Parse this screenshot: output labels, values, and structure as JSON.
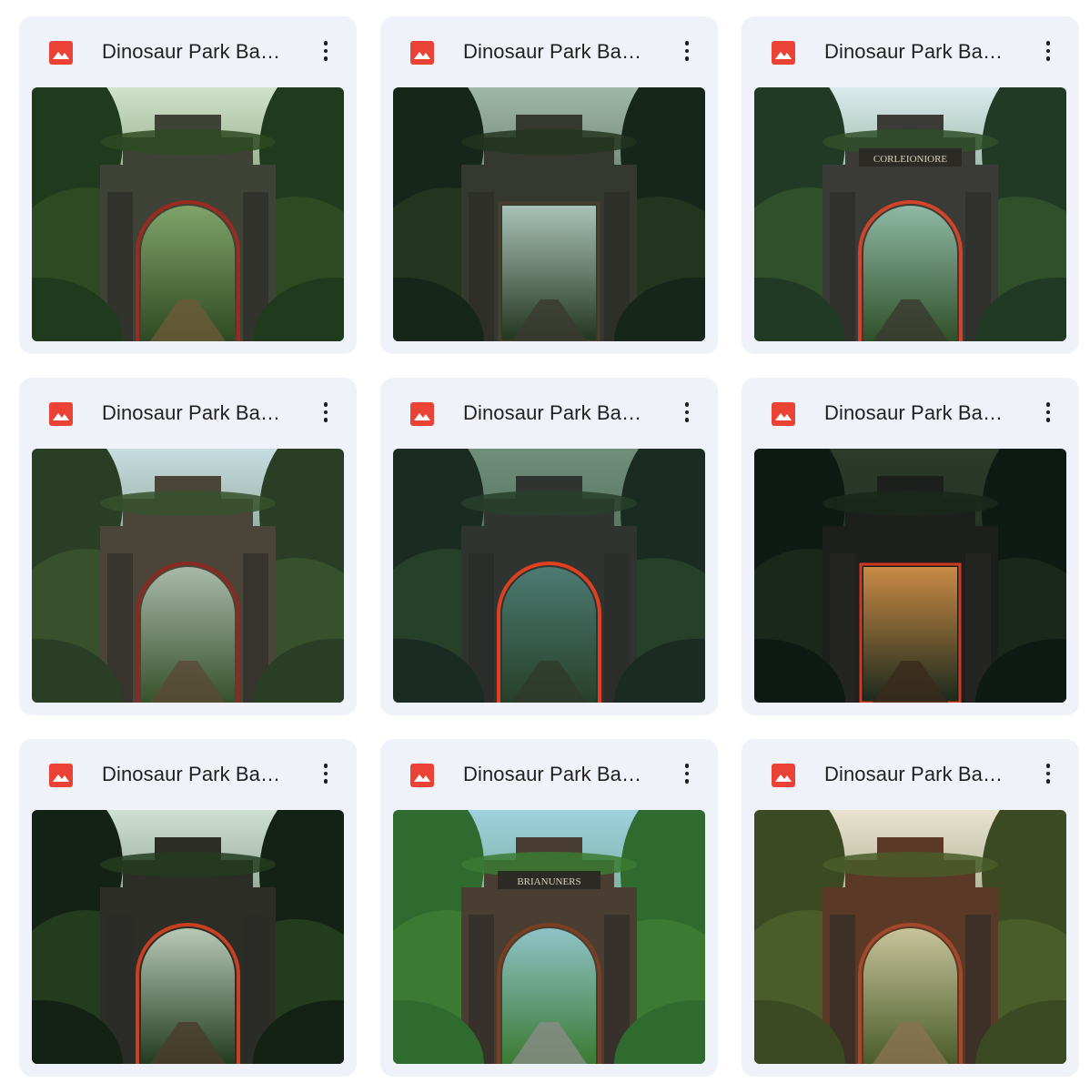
{
  "files": [
    {
      "name": "Dinosaur Park Backdrops",
      "variant": "jungle-gate-arch",
      "icon": "image-file-icon"
    },
    {
      "name": "Dinosaur Park Backdrops",
      "variant": "jungle-gate-square",
      "icon": "image-file-icon"
    },
    {
      "name": "Dinosaur Park Backdrops",
      "variant": "jungle-gate-lit",
      "icon": "image-file-icon"
    },
    {
      "name": "Dinosaur Park Backdrops",
      "variant": "jungle-gate-arch",
      "icon": "image-file-icon"
    },
    {
      "name": "Dinosaur Park Backdrops",
      "variant": "jungle-gate-lit",
      "icon": "image-file-icon"
    },
    {
      "name": "Dinosaur Park Backdrops",
      "variant": "jungle-gate-glow",
      "icon": "image-file-icon"
    },
    {
      "name": "Dinosaur Park Backdrops",
      "variant": "jungle-gate-stairs",
      "icon": "image-file-icon"
    },
    {
      "name": "Dinosaur Park Backdrops",
      "variant": "jungle-gate-sign",
      "icon": "image-file-icon"
    },
    {
      "name": "Dinosaur Park Backdrops",
      "variant": "jungle-gate-sunny",
      "icon": "image-file-icon"
    }
  ],
  "colors": {
    "card_bg": "#eff2f8",
    "image_icon_red": "#ea4335",
    "text": "#1f1f1f"
  },
  "signs": {
    "third": "CORLEIONIORE",
    "eighth": "BRIANUNERS"
  }
}
